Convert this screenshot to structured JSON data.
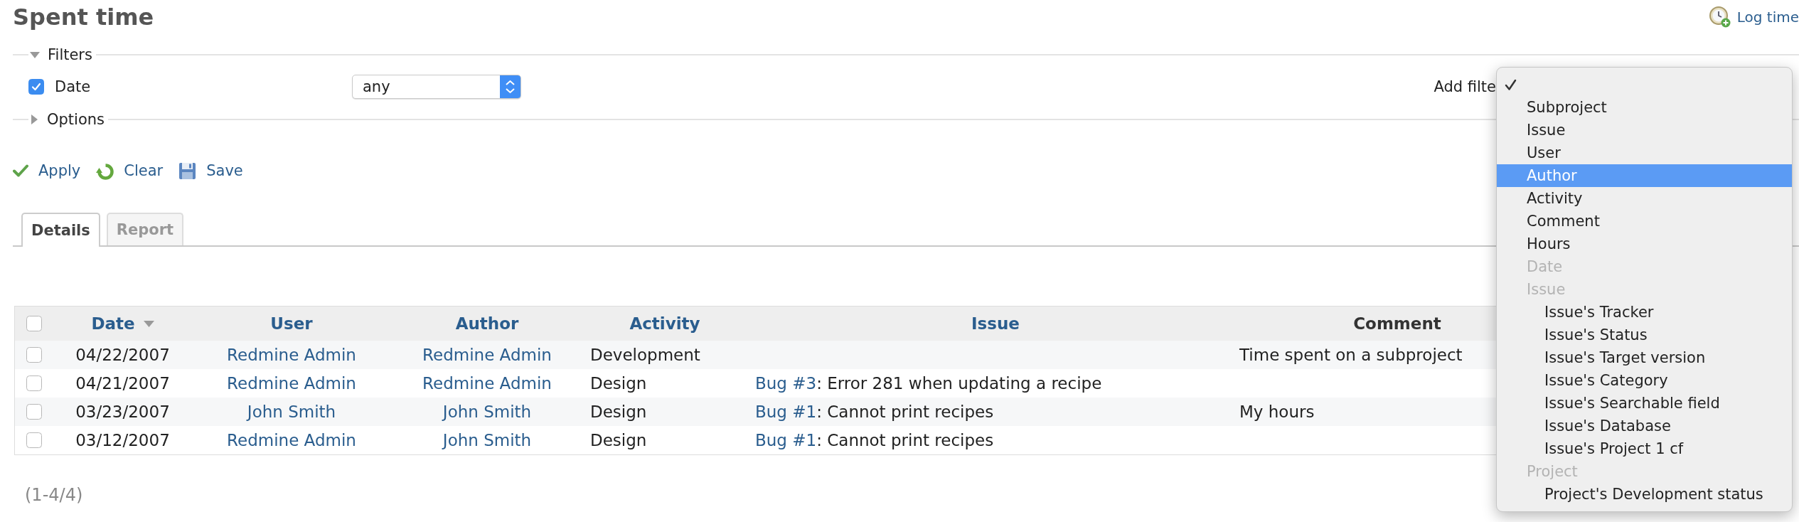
{
  "page": {
    "title": "Spent time"
  },
  "log_time": {
    "label": "Log time"
  },
  "filters": {
    "label": "Filters",
    "expanded": true,
    "rows": [
      {
        "label": "Date",
        "checked": true,
        "operator": "any"
      }
    ],
    "add_filter": {
      "label": "Add filte",
      "menu": {
        "items": [
          {
            "kind": "blank",
            "checked": true,
            "highlighted": false
          },
          {
            "kind": "option",
            "label": "Subproject",
            "checked": false,
            "highlighted": false
          },
          {
            "kind": "option",
            "label": "Issue",
            "checked": false,
            "highlighted": false
          },
          {
            "kind": "option",
            "label": "User",
            "checked": false,
            "highlighted": false
          },
          {
            "kind": "option",
            "label": "Author",
            "checked": false,
            "highlighted": true
          },
          {
            "kind": "option",
            "label": "Activity",
            "checked": false,
            "highlighted": false
          },
          {
            "kind": "option",
            "label": "Comment",
            "checked": false,
            "highlighted": false
          },
          {
            "kind": "option",
            "label": "Hours",
            "checked": false,
            "highlighted": false
          },
          {
            "kind": "group",
            "label": "Date"
          },
          {
            "kind": "group",
            "label": "Issue",
            "children": [
              {
                "kind": "option",
                "label": "Issue's Tracker",
                "checked": false,
                "highlighted": false
              },
              {
                "kind": "option",
                "label": "Issue's Status",
                "checked": false,
                "highlighted": false
              },
              {
                "kind": "option",
                "label": "Issue's Target version",
                "checked": false,
                "highlighted": false
              },
              {
                "kind": "option",
                "label": "Issue's Category",
                "checked": false,
                "highlighted": false
              },
              {
                "kind": "option",
                "label": "Issue's Searchable field",
                "checked": false,
                "highlighted": false
              },
              {
                "kind": "option",
                "label": "Issue's Database",
                "checked": false,
                "highlighted": false
              },
              {
                "kind": "option",
                "label": "Issue's Project 1 cf",
                "checked": false,
                "highlighted": false
              }
            ]
          },
          {
            "kind": "group",
            "label": "Project",
            "children": [
              {
                "kind": "option",
                "label": "Project's Development status",
                "checked": false,
                "highlighted": false
              }
            ]
          }
        ]
      }
    }
  },
  "options": {
    "label": "Options",
    "expanded": false
  },
  "actions": [
    {
      "kind": "apply",
      "label": "Apply"
    },
    {
      "kind": "clear",
      "label": "Clear"
    },
    {
      "kind": "save",
      "label": "Save"
    }
  ],
  "tabs": [
    {
      "label": "Details",
      "selected": true
    },
    {
      "label": "Report",
      "selected": false
    }
  ],
  "table": {
    "all_checked": false,
    "columns": [
      {
        "label": "Date",
        "sortable": true,
        "sorted": true
      },
      {
        "label": "User",
        "sortable": true,
        "sorted": false
      },
      {
        "label": "Author",
        "sortable": true,
        "sorted": false
      },
      {
        "label": "Activity",
        "sortable": true,
        "sorted": false
      },
      {
        "label": "Issue",
        "sortable": true,
        "sorted": false
      },
      {
        "label": "Comment",
        "sortable": false,
        "sorted": false
      }
    ],
    "rows": [
      {
        "checked": false,
        "date": "04/22/2007",
        "user": "Redmine Admin",
        "author": "Redmine Admin",
        "activity": "Development",
        "comment": "Time spent on a subproject"
      },
      {
        "checked": false,
        "date": "04/21/2007",
        "user": "Redmine Admin",
        "author": "Redmine Admin",
        "activity": "Design",
        "issue": {
          "link": "Bug #3",
          "text": ": Error 281 when updating a recipe"
        }
      },
      {
        "checked": false,
        "date": "03/23/2007",
        "user": "John Smith",
        "author": "John Smith",
        "activity": "Design",
        "issue": {
          "link": "Bug #1",
          "text": ": Cannot print recipes"
        },
        "comment": "My hours"
      },
      {
        "checked": false,
        "date": "03/12/2007",
        "user": "Redmine Admin",
        "author": "John Smith",
        "activity": "Design",
        "issue": {
          "link": "Bug #1",
          "text": ": Cannot print recipes"
        }
      }
    ]
  },
  "pagination": "(1-4/4)"
}
